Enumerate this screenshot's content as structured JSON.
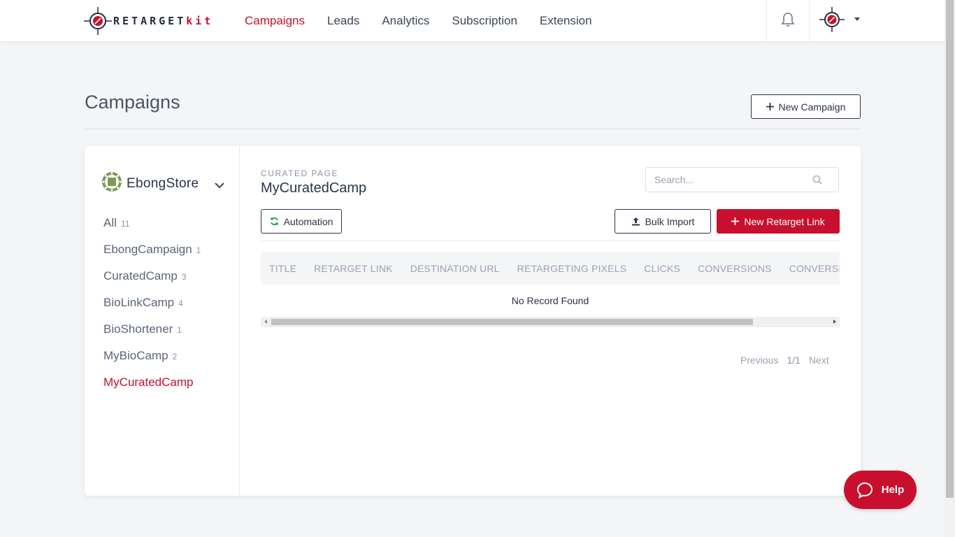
{
  "brand": {
    "logo_text_main": "RETARGET",
    "logo_text_accent": "kit",
    "accent_color": "#c8102e"
  },
  "nav": {
    "items": [
      {
        "label": "Campaigns",
        "active": true
      },
      {
        "label": "Leads"
      },
      {
        "label": "Analytics"
      },
      {
        "label": "Subscription"
      },
      {
        "label": "Extension"
      }
    ]
  },
  "header": {
    "title": "Campaigns",
    "new_campaign_label": "New Campaign"
  },
  "sidebar": {
    "store_name": "EbongStore",
    "items": [
      {
        "label": "All",
        "count": "11"
      },
      {
        "label": "EbongCampaign",
        "count": "1"
      },
      {
        "label": "CuratedCamp",
        "count": "3"
      },
      {
        "label": "BioLinkCamp",
        "count": "4"
      },
      {
        "label": "BioShortener",
        "count": "1"
      },
      {
        "label": "MyBioCamp",
        "count": "2"
      },
      {
        "label": "MyCuratedCamp",
        "count": "",
        "active": true
      }
    ]
  },
  "main": {
    "type_label": "CURATED PAGE",
    "campaign_title": "MyCuratedCamp",
    "search_placeholder": "Search...",
    "automation_label": "Automation",
    "bulk_import_label": "Bulk Import",
    "new_link_label": "New Retarget Link",
    "table": {
      "columns": [
        "TITLE",
        "RETARGET LINK",
        "DESTINATION URL",
        "RETARGETING PIXELS",
        "CLICKS",
        "CONVERSIONS",
        "CONVERSION RATE"
      ],
      "empty_text": "No Record Found"
    },
    "pagination": {
      "previous": "Previous",
      "page": "1/1",
      "next": "Next"
    }
  },
  "help_label": "Help"
}
